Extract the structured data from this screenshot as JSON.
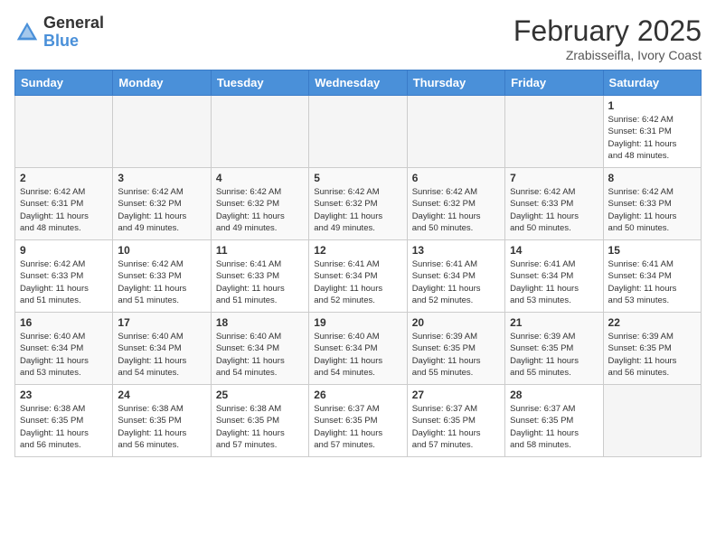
{
  "header": {
    "logo_general": "General",
    "logo_blue": "Blue",
    "month_title": "February 2025",
    "location": "Zrabisseifla, Ivory Coast"
  },
  "weekdays": [
    "Sunday",
    "Monday",
    "Tuesday",
    "Wednesday",
    "Thursday",
    "Friday",
    "Saturday"
  ],
  "weeks": [
    [
      {
        "day": "",
        "info": ""
      },
      {
        "day": "",
        "info": ""
      },
      {
        "day": "",
        "info": ""
      },
      {
        "day": "",
        "info": ""
      },
      {
        "day": "",
        "info": ""
      },
      {
        "day": "",
        "info": ""
      },
      {
        "day": "1",
        "info": "Sunrise: 6:42 AM\nSunset: 6:31 PM\nDaylight: 11 hours\nand 48 minutes."
      }
    ],
    [
      {
        "day": "2",
        "info": "Sunrise: 6:42 AM\nSunset: 6:31 PM\nDaylight: 11 hours\nand 48 minutes."
      },
      {
        "day": "3",
        "info": "Sunrise: 6:42 AM\nSunset: 6:32 PM\nDaylight: 11 hours\nand 49 minutes."
      },
      {
        "day": "4",
        "info": "Sunrise: 6:42 AM\nSunset: 6:32 PM\nDaylight: 11 hours\nand 49 minutes."
      },
      {
        "day": "5",
        "info": "Sunrise: 6:42 AM\nSunset: 6:32 PM\nDaylight: 11 hours\nand 49 minutes."
      },
      {
        "day": "6",
        "info": "Sunrise: 6:42 AM\nSunset: 6:32 PM\nDaylight: 11 hours\nand 50 minutes."
      },
      {
        "day": "7",
        "info": "Sunrise: 6:42 AM\nSunset: 6:33 PM\nDaylight: 11 hours\nand 50 minutes."
      },
      {
        "day": "8",
        "info": "Sunrise: 6:42 AM\nSunset: 6:33 PM\nDaylight: 11 hours\nand 50 minutes."
      }
    ],
    [
      {
        "day": "9",
        "info": "Sunrise: 6:42 AM\nSunset: 6:33 PM\nDaylight: 11 hours\nand 51 minutes."
      },
      {
        "day": "10",
        "info": "Sunrise: 6:42 AM\nSunset: 6:33 PM\nDaylight: 11 hours\nand 51 minutes."
      },
      {
        "day": "11",
        "info": "Sunrise: 6:41 AM\nSunset: 6:33 PM\nDaylight: 11 hours\nand 51 minutes."
      },
      {
        "day": "12",
        "info": "Sunrise: 6:41 AM\nSunset: 6:34 PM\nDaylight: 11 hours\nand 52 minutes."
      },
      {
        "day": "13",
        "info": "Sunrise: 6:41 AM\nSunset: 6:34 PM\nDaylight: 11 hours\nand 52 minutes."
      },
      {
        "day": "14",
        "info": "Sunrise: 6:41 AM\nSunset: 6:34 PM\nDaylight: 11 hours\nand 53 minutes."
      },
      {
        "day": "15",
        "info": "Sunrise: 6:41 AM\nSunset: 6:34 PM\nDaylight: 11 hours\nand 53 minutes."
      }
    ],
    [
      {
        "day": "16",
        "info": "Sunrise: 6:40 AM\nSunset: 6:34 PM\nDaylight: 11 hours\nand 53 minutes."
      },
      {
        "day": "17",
        "info": "Sunrise: 6:40 AM\nSunset: 6:34 PM\nDaylight: 11 hours\nand 54 minutes."
      },
      {
        "day": "18",
        "info": "Sunrise: 6:40 AM\nSunset: 6:34 PM\nDaylight: 11 hours\nand 54 minutes."
      },
      {
        "day": "19",
        "info": "Sunrise: 6:40 AM\nSunset: 6:34 PM\nDaylight: 11 hours\nand 54 minutes."
      },
      {
        "day": "20",
        "info": "Sunrise: 6:39 AM\nSunset: 6:35 PM\nDaylight: 11 hours\nand 55 minutes."
      },
      {
        "day": "21",
        "info": "Sunrise: 6:39 AM\nSunset: 6:35 PM\nDaylight: 11 hours\nand 55 minutes."
      },
      {
        "day": "22",
        "info": "Sunrise: 6:39 AM\nSunset: 6:35 PM\nDaylight: 11 hours\nand 56 minutes."
      }
    ],
    [
      {
        "day": "23",
        "info": "Sunrise: 6:38 AM\nSunset: 6:35 PM\nDaylight: 11 hours\nand 56 minutes."
      },
      {
        "day": "24",
        "info": "Sunrise: 6:38 AM\nSunset: 6:35 PM\nDaylight: 11 hours\nand 56 minutes."
      },
      {
        "day": "25",
        "info": "Sunrise: 6:38 AM\nSunset: 6:35 PM\nDaylight: 11 hours\nand 57 minutes."
      },
      {
        "day": "26",
        "info": "Sunrise: 6:37 AM\nSunset: 6:35 PM\nDaylight: 11 hours\nand 57 minutes."
      },
      {
        "day": "27",
        "info": "Sunrise: 6:37 AM\nSunset: 6:35 PM\nDaylight: 11 hours\nand 57 minutes."
      },
      {
        "day": "28",
        "info": "Sunrise: 6:37 AM\nSunset: 6:35 PM\nDaylight: 11 hours\nand 58 minutes."
      },
      {
        "day": "",
        "info": ""
      }
    ]
  ]
}
